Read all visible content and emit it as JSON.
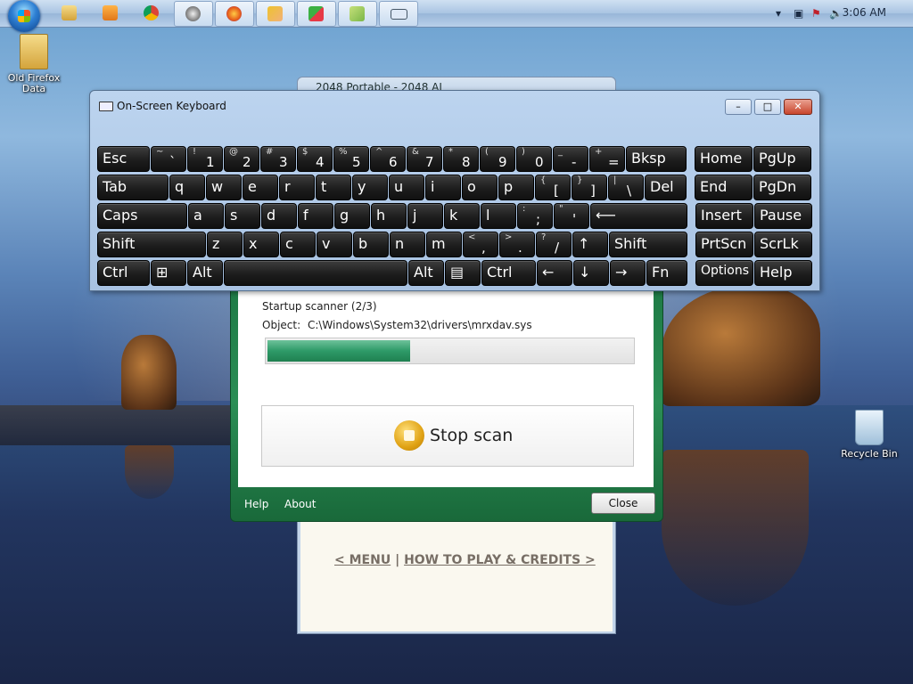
{
  "taskbar": {
    "clock": "3:06 AM",
    "buttons": [
      "explorer",
      "media-player",
      "chrome",
      "steam",
      "firefox",
      "app",
      "painter",
      "tools",
      "on-screen-keyboard"
    ]
  },
  "desktop": {
    "icons": [
      {
        "name": "folder-icon",
        "label": "Old Firefox Data"
      },
      {
        "name": "recycle-bin-icon",
        "label": "Recycle Bin"
      }
    ]
  },
  "win2048": {
    "title": "2048 Portable - 2048 AI",
    "menu_link": "< MENU",
    "separator": "|",
    "help_link": "HOW TO PLAY & CREDITS >"
  },
  "scanner": {
    "status": "Startup scanner (2/3)",
    "object_label": "Object:",
    "object_path": "C:\\Windows\\System32\\drivers\\mrxdav.sys",
    "progress": 0.39,
    "stop_label": "Stop scan",
    "help": "Help",
    "about": "About",
    "close": "Close"
  },
  "osk": {
    "title": "On-Screen Keyboard",
    "rows": [
      [
        {
          "main": "Esc",
          "w": 57
        },
        {
          "shift": "~",
          "main": "`",
          "w": 38
        },
        {
          "shift": "!",
          "main": "1",
          "w": 38
        },
        {
          "shift": "@",
          "main": "2",
          "w": 38
        },
        {
          "shift": "#",
          "main": "3",
          "w": 38
        },
        {
          "shift": "$",
          "main": "4",
          "w": 38
        },
        {
          "shift": "%",
          "main": "5",
          "w": 38
        },
        {
          "shift": "^",
          "main": "6",
          "w": 38
        },
        {
          "shift": "&",
          "main": "7",
          "w": 38
        },
        {
          "shift": "*",
          "main": "8",
          "w": 38
        },
        {
          "shift": "(",
          "main": "9",
          "w": 38
        },
        {
          "shift": ")",
          "main": "0",
          "w": 38
        },
        {
          "shift": "_",
          "main": "-",
          "w": 38
        },
        {
          "shift": "+",
          "main": "=",
          "w": 38
        },
        {
          "main": "Bksp",
          "w": 66
        },
        {
          "main": "Home",
          "w": 63,
          "gap": 8
        },
        {
          "main": "PgUp",
          "w": 63
        }
      ],
      [
        {
          "main": "Tab",
          "w": 78
        },
        {
          "main": "q",
          "w": 38
        },
        {
          "main": "w",
          "w": 38
        },
        {
          "main": "e",
          "w": 38
        },
        {
          "main": "r",
          "w": 38
        },
        {
          "main": "t",
          "w": 38
        },
        {
          "main": "y",
          "w": 38
        },
        {
          "main": "u",
          "w": 38
        },
        {
          "main": "i",
          "w": 38
        },
        {
          "main": "o",
          "w": 38
        },
        {
          "main": "p",
          "w": 38
        },
        {
          "shift": "{",
          "main": "[",
          "w": 38
        },
        {
          "shift": "}",
          "main": "]",
          "w": 38
        },
        {
          "shift": "|",
          "main": "\\",
          "w": 38
        },
        {
          "main": "Del",
          "w": 45
        },
        {
          "main": "End",
          "w": 63,
          "gap": 8
        },
        {
          "main": "PgDn",
          "w": 63
        }
      ],
      [
        {
          "main": "Caps",
          "w": 99
        },
        {
          "main": "a",
          "w": 38
        },
        {
          "main": "s",
          "w": 38
        },
        {
          "main": "d",
          "w": 38
        },
        {
          "main": "f",
          "w": 38
        },
        {
          "main": "g",
          "w": 38
        },
        {
          "main": "h",
          "w": 38
        },
        {
          "main": "j",
          "w": 38
        },
        {
          "main": "k",
          "w": 38
        },
        {
          "main": "l",
          "w": 38
        },
        {
          "shift": ":",
          "main": ";",
          "w": 38
        },
        {
          "shift": "\"",
          "main": "'",
          "w": 38
        },
        {
          "main": "⟵",
          "w": 107
        },
        {
          "main": "Insert",
          "w": 63,
          "gap": 8
        },
        {
          "main": "Pause",
          "w": 63
        }
      ],
      [
        {
          "main": "Shift",
          "w": 120
        },
        {
          "main": "z",
          "w": 38
        },
        {
          "main": "x",
          "w": 38
        },
        {
          "main": "c",
          "w": 38
        },
        {
          "main": "v",
          "w": 38
        },
        {
          "main": "b",
          "w": 38
        },
        {
          "main": "n",
          "w": 38
        },
        {
          "main": "m",
          "w": 38
        },
        {
          "shift": "<",
          "main": ",",
          "w": 38
        },
        {
          "shift": ">",
          "main": ".",
          "w": 38
        },
        {
          "shift": "?",
          "main": "/",
          "w": 38
        },
        {
          "main": "↑",
          "w": 38
        },
        {
          "main": "Shift",
          "w": 86
        },
        {
          "main": "PrtScn",
          "w": 63,
          "gap": 8
        },
        {
          "main": "ScrLk",
          "w": 63
        }
      ],
      [
        {
          "main": "Ctrl",
          "w": 57
        },
        {
          "main": "⊞",
          "w": 38
        },
        {
          "main": "Alt",
          "w": 38
        },
        {
          "main": "",
          "w": 204
        },
        {
          "main": "Alt",
          "w": 38
        },
        {
          "main": "▤",
          "w": 38
        },
        {
          "main": "Ctrl",
          "w": 59
        },
        {
          "main": "←",
          "w": 38
        },
        {
          "main": "↓",
          "w": 38
        },
        {
          "main": "→",
          "w": 38
        },
        {
          "main": "Fn",
          "w": 44
        },
        {
          "main": "Options",
          "w": 63,
          "gap": 8,
          "small": true
        },
        {
          "main": "Help",
          "w": 63
        }
      ]
    ]
  }
}
